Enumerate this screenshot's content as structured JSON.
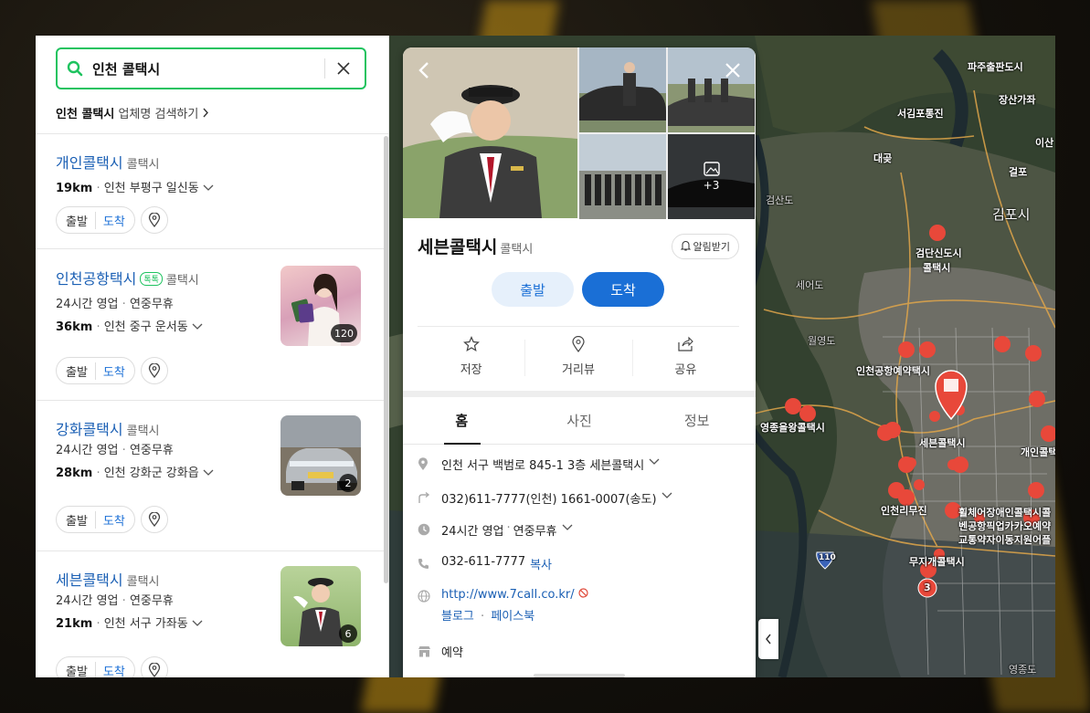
{
  "search": {
    "query": "인천 콜택시",
    "business_search_keyword": "인천 콜택시",
    "business_search_text": "업체명 검색하기"
  },
  "results": [
    {
      "name": "개인콜택시",
      "category": "콜택시",
      "distance": "19km",
      "address": "인천 부평구 일신동"
    },
    {
      "name": "인천공항택시",
      "talk_badge": "톡톡",
      "category": "콜택시",
      "hours": "24시간 영업",
      "holiday": "연중무휴",
      "distance": "36km",
      "address": "인천 중구 운서동",
      "photo_count": "120"
    },
    {
      "name": "강화콜택시",
      "category": "콜택시",
      "hours": "24시간 영업",
      "holiday": "연중무휴",
      "distance": "28km",
      "address": "인천 강화군 강화읍",
      "photo_count": "2"
    },
    {
      "name": "세븐콜택시",
      "category": "콜택시",
      "hours": "24시간 영업",
      "holiday": "연중무휴",
      "distance": "21km",
      "address": "인천 서구 가좌동",
      "photo_count": "6"
    }
  ],
  "list_buttons": {
    "depart": "출발",
    "arrive": "도착"
  },
  "detail": {
    "name": "세븐콜택시",
    "category": "콜택시",
    "notify": "알림받기",
    "more_photos": "+3",
    "depart": "출발",
    "arrive": "도착",
    "actions": {
      "save": "저장",
      "distance_view": "거리뷰",
      "share": "공유"
    },
    "tabs": {
      "home": "홈",
      "photos": "사진",
      "info": "정보"
    },
    "address": "인천 서구 백범로 845-1 3층 세븐콜택시",
    "phone_main": "032)611-7777(인천) 1661-0007(송도)",
    "hours": "24시간 영업",
    "holiday": "연중무휴",
    "phone": "032-611-7777",
    "copy": "복사",
    "website": "http://www.7call.co.kr/",
    "blog": "블로그",
    "facebook": "페이스북",
    "reserve": "예약"
  },
  "map_labels": {
    "l1": "파주출판도시",
    "l2": "장산가좌",
    "l3": "서김포통진",
    "l4": "대곶",
    "l5": "이산",
    "l6": "걸포",
    "l7": "김포시",
    "l8": "검단신도시",
    "l9": "콜택시",
    "l10": "세어도",
    "l11": "인천공항예약택시",
    "l12": "영종을왕콜택시",
    "l13": "세븐콜택시",
    "l14": "개인콜택",
    "l15": "인천리무진",
    "l16": "휠체어장애인콜택시콜",
    "l17": "벤공항픽업카카오예약",
    "l18": "교통약자이동지원어플",
    "l19": "무지개콜택시",
    "l20": "검산도",
    "l21": "월영도",
    "l22": "110",
    "l23": "3",
    "l24": "영종도"
  },
  "colors": {
    "accent": "#1a6fd6",
    "search_border": "#1ec35f",
    "map_marker": "#e8483a"
  }
}
